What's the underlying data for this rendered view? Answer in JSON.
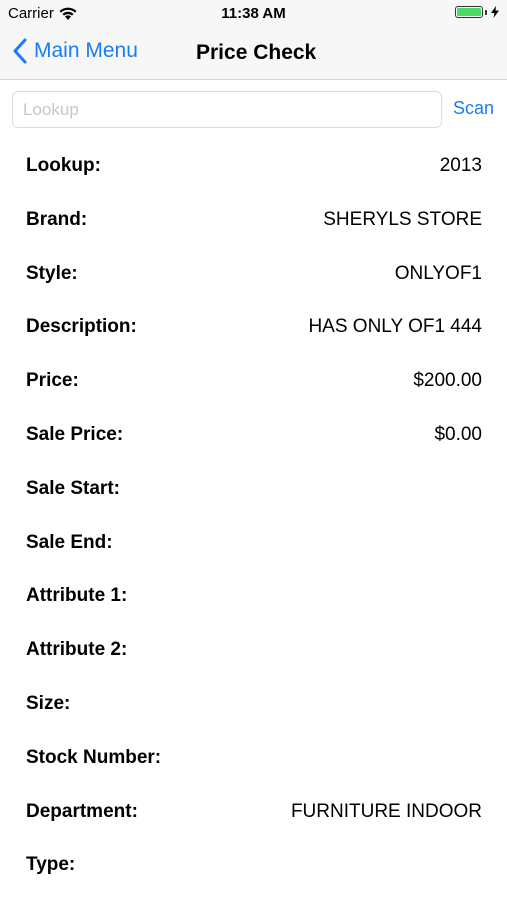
{
  "status_bar": {
    "carrier": "Carrier",
    "time": "11:38 AM",
    "battery_level": 1.0,
    "battery_color": "#4cd964"
  },
  "nav": {
    "back_label": "Main Menu",
    "title": "Price Check",
    "accent_color": "#1a7cf5"
  },
  "search": {
    "placeholder": "Lookup",
    "value": "",
    "scan_label": "Scan"
  },
  "details": [
    {
      "label": "Lookup:",
      "value": "2013"
    },
    {
      "label": "Brand:",
      "value": "SHERYLS STORE"
    },
    {
      "label": "Style:",
      "value": "ONLYOF1"
    },
    {
      "label": "Description:",
      "value": "HAS ONLY OF1 444"
    },
    {
      "label": "Price:",
      "value": "$200.00"
    },
    {
      "label": "Sale Price:",
      "value": "$0.00"
    },
    {
      "label": "Sale Start:",
      "value": ""
    },
    {
      "label": "Sale End:",
      "value": ""
    },
    {
      "label": "Attribute 1:",
      "value": ""
    },
    {
      "label": "Attribute 2:",
      "value": ""
    },
    {
      "label": "Size:",
      "value": ""
    },
    {
      "label": "Stock Number:",
      "value": ""
    },
    {
      "label": "Department:",
      "value": "FURNITURE INDOOR"
    },
    {
      "label": "Type:",
      "value": ""
    }
  ]
}
